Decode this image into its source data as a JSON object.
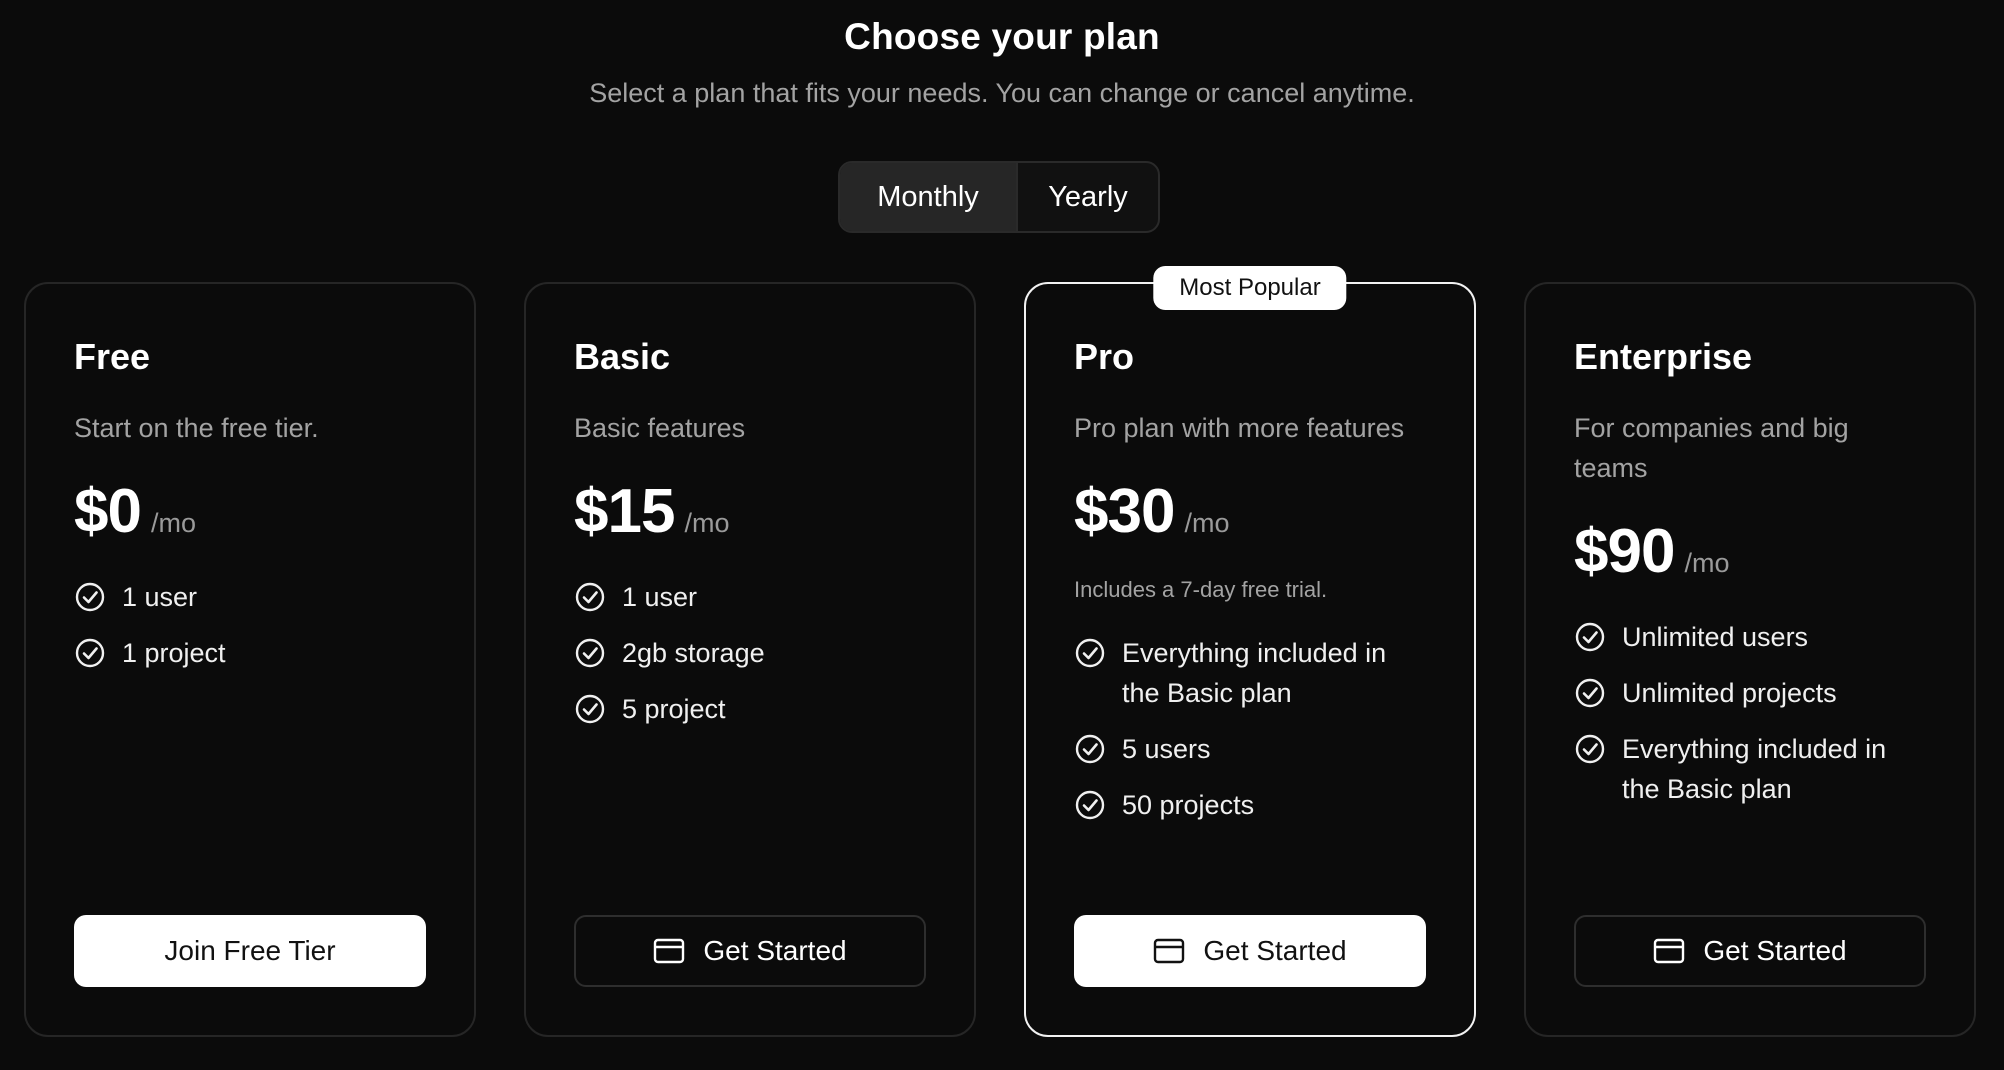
{
  "header": {
    "title": "Choose your plan",
    "subtitle": "Select a plan that fits your needs. You can change or cancel anytime."
  },
  "billing_toggle": {
    "options": [
      "Monthly",
      "Yearly"
    ],
    "selected": "Monthly"
  },
  "plans": [
    {
      "name": "Free",
      "description": "Start on the free tier.",
      "price": "$0",
      "period": "/mo",
      "features": [
        "1 user",
        "1 project"
      ],
      "cta": "Join Free Tier"
    },
    {
      "name": "Basic",
      "description": "Basic features",
      "price": "$15",
      "period": "/mo",
      "features": [
        "1 user",
        "2gb storage",
        "5 project"
      ],
      "cta": "Get Started"
    },
    {
      "name": "Pro",
      "badge": "Most Popular",
      "description": "Pro plan with more features",
      "price": "$30",
      "period": "/mo",
      "note": "Includes a 7-day free trial.",
      "features": [
        "Everything included in the Basic plan",
        "5 users",
        "50 projects"
      ],
      "cta": "Get Started"
    },
    {
      "name": "Enterprise",
      "description": "For companies and big teams",
      "price": "$90",
      "period": "/mo",
      "features": [
        "Unlimited users",
        "Unlimited projects",
        "Everything included in the Basic plan"
      ],
      "cta": "Get Started"
    }
  ],
  "icons": {
    "feature": "check-circle-icon",
    "cta": "credit-card-icon"
  },
  "colors": {
    "background": "#0b0b0b",
    "card_border": "#262626",
    "featured_border": "#f2f2f2",
    "muted_text": "#a3a3a3",
    "button_light": "#ffffff"
  }
}
